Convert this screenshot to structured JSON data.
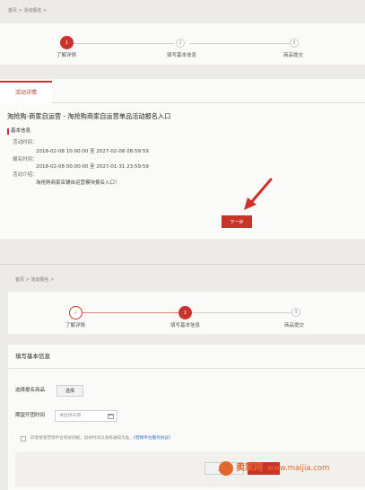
{
  "top": {
    "breadcrumb": {
      "home": "首页",
      "current": "活动报名"
    },
    "steps": [
      {
        "num": "1",
        "label": "了解详情"
      },
      {
        "num": "2",
        "label": "填写基本信息"
      },
      {
        "num": "3",
        "label": "商品提交"
      }
    ],
    "tab_label": "活动详情",
    "activity_title": "淘抢购-商家自运营 - 淘抢购商家自运营单品活动报名入口",
    "section_label": "基本信息",
    "activity_time_label": "活动时间：",
    "activity_time_value": "2018-02-08 10:00:00 至 2027-02-08 08:59:59",
    "signup_time_label": "报名时间：",
    "signup_time_value": "2018-02-08 00:00:00 至 2027-01-31 23:59:59",
    "intro_label": "活动介绍：",
    "intro_value": "淘抢购商家店铺自运营模块报名入口！",
    "next_button": "下一步"
  },
  "bottom": {
    "breadcrumb": {
      "home": "首页",
      "current": "活动报名"
    },
    "steps": [
      {
        "num": "✓",
        "label": "了解详情"
      },
      {
        "num": "2",
        "label": "填写基本信息"
      },
      {
        "num": "3",
        "label": "商品提交"
      }
    ],
    "section_title": "填写基本信息",
    "select_product_label": "选择报名商品",
    "select_button": "选择",
    "date_label": "期望开团时间",
    "date_placeholder": "请选择日期",
    "agree_text": "同意接受营销平台系统则规，具体时间以系统通知为准。",
    "agree_link": "《营销平台服务协议》",
    "prev_button": "上一步"
  },
  "watermark": {
    "brand": "卖家网",
    "url": "www.maijia.com"
  },
  "colors": {
    "accent": "#c9342a",
    "link": "#2e6fb8"
  }
}
